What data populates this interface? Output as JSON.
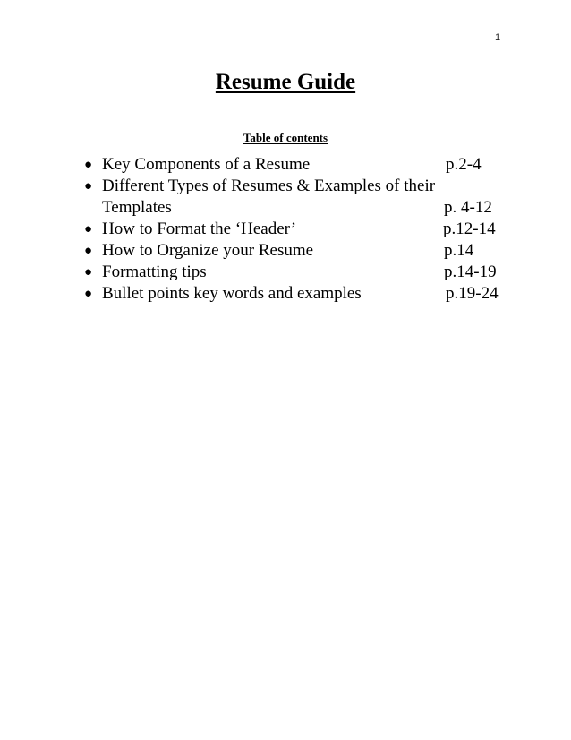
{
  "page_number": "1",
  "title": "Resume Guide",
  "toc_heading": "Table of contents",
  "bullet_glyph": "●",
  "toc": [
    {
      "label": "Key Components of a Resume",
      "page": "p.2-4"
    },
    {
      "label": "Different Types of Resumes & Examples of their",
      "continuation": "Templates",
      "page": "p. 4-12"
    },
    {
      "label": "How to Format the ‘Header’",
      "page": "p.12-14"
    },
    {
      "label": "How to Organize your Resume",
      "page": "p.14"
    },
    {
      "label": "Formatting tips",
      "page": "p.14-19"
    },
    {
      "label": "Bullet points key words and examples",
      "page": "p.19-24"
    }
  ]
}
